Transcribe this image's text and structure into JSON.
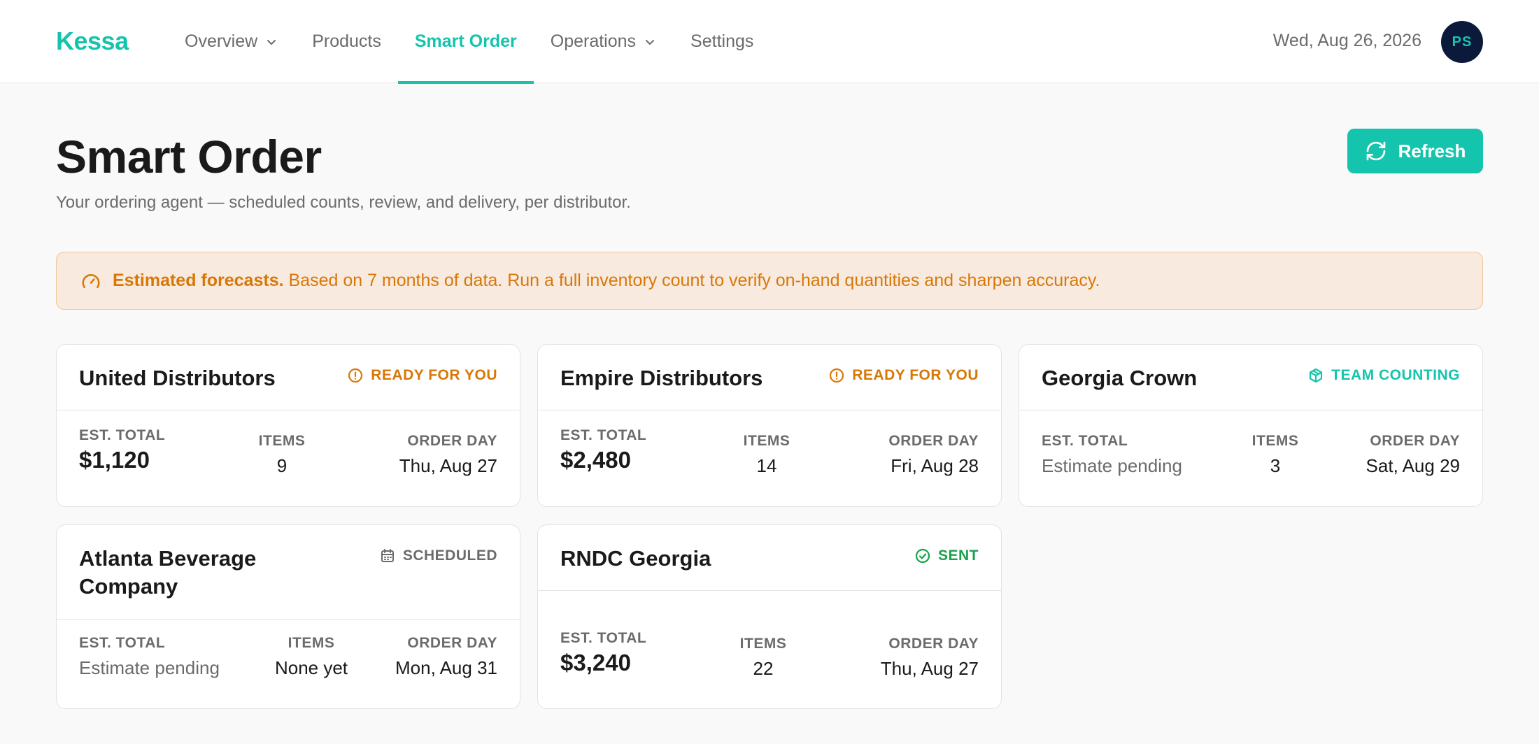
{
  "app": {
    "name": "Kessa"
  },
  "nav": {
    "items": [
      {
        "label": "Overview",
        "dropdown": true,
        "active": false
      },
      {
        "label": "Products",
        "dropdown": false,
        "active": false
      },
      {
        "label": "Smart Order",
        "dropdown": false,
        "active": true
      },
      {
        "label": "Operations",
        "dropdown": true,
        "active": false
      },
      {
        "label": "Settings",
        "dropdown": false,
        "active": false
      }
    ]
  },
  "header": {
    "date": "Wed, Aug 26, 2026",
    "avatar_initials": "PS"
  },
  "page": {
    "title": "Smart Order",
    "subtitle": "Your ordering agent — scheduled counts, review, and delivery, per distributor.",
    "refresh_label": "Refresh"
  },
  "banner": {
    "bold": "Estimated forecasts.",
    "text": " Based on 7 months of data. Run a full inventory count to verify on-hand quantities and sharpen accuracy."
  },
  "labels": {
    "est_total": "EST. TOTAL",
    "items": "ITEMS",
    "order_day": "ORDER DAY"
  },
  "colors": {
    "accent": "#14c4ad",
    "ready": "#d97706",
    "counting": "#14c4ad",
    "scheduled": "#6b6b6b",
    "sent": "#16a34a"
  },
  "cards": [
    {
      "name": "United Distributors",
      "status": "READY FOR YOU",
      "status_icon": "alert-circle-icon",
      "est_total": "$1,120",
      "items": "9",
      "order_day": "Thu, Aug 27"
    },
    {
      "name": "Empire Distributors",
      "status": "READY FOR YOU",
      "status_icon": "alert-circle-icon",
      "est_total": "$2,480",
      "items": "14",
      "order_day": "Fri, Aug 28"
    },
    {
      "name": "Georgia Crown",
      "status": "TEAM COUNTING",
      "status_icon": "box-icon",
      "est_total": "Estimate pending",
      "items": "3",
      "order_day": "Sat, Aug 29"
    },
    {
      "name": "Atlanta Beverage Company",
      "status": "SCHEDULED",
      "status_icon": "calendar-icon",
      "est_total": "Estimate pending",
      "items": "None yet",
      "order_day": "Mon, Aug 31"
    },
    {
      "name": "RNDC Georgia",
      "status": "SENT",
      "status_icon": "check-circle-icon",
      "est_total": "$3,240",
      "items": "22",
      "order_day": "Thu, Aug 27"
    }
  ]
}
